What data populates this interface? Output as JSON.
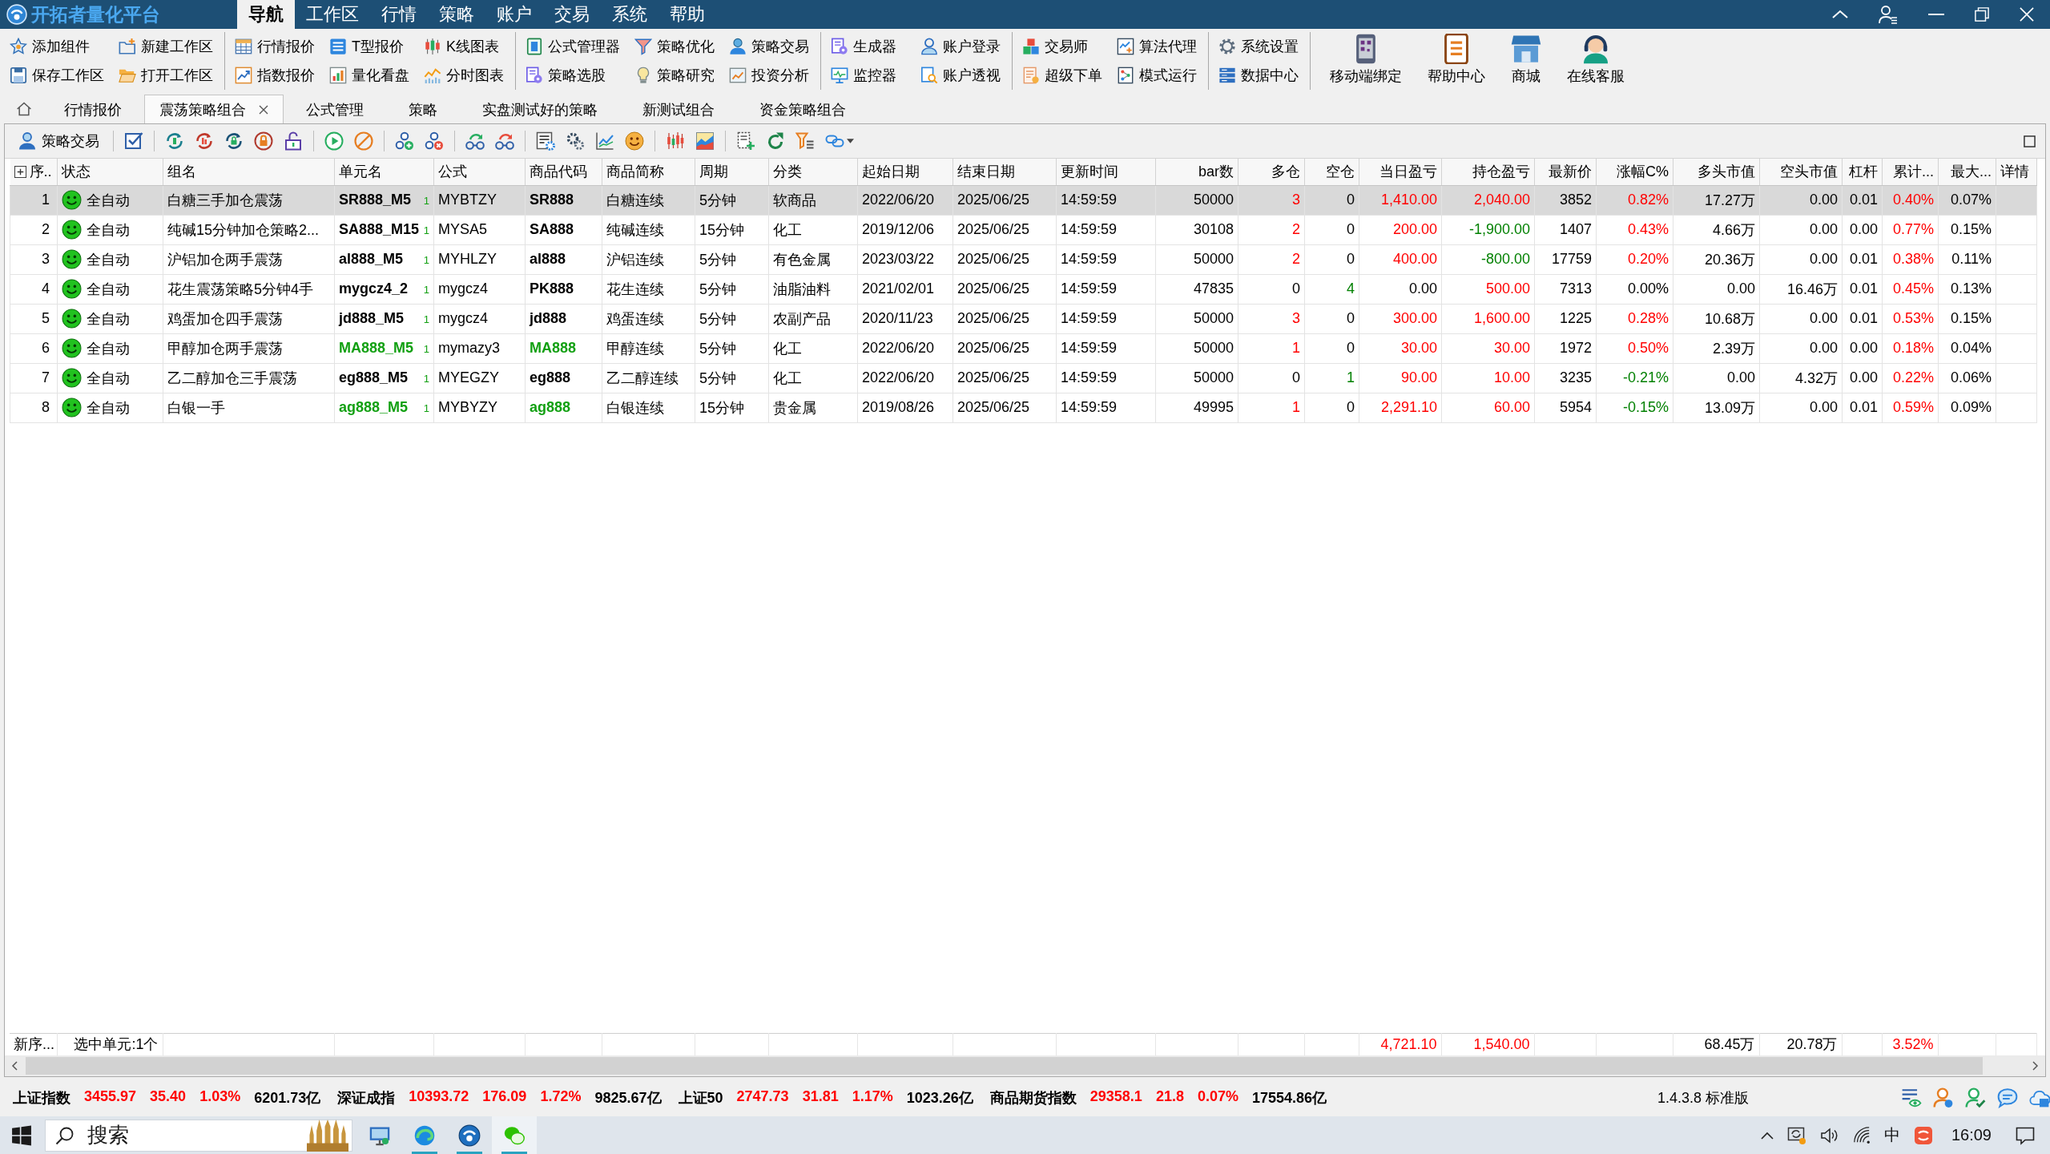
{
  "app_title": "开拓者量化平台",
  "menu": [
    {
      "label": "导航",
      "selected": true
    },
    {
      "label": "工作区",
      "selected": false
    },
    {
      "label": "行情",
      "selected": false
    },
    {
      "label": "策略",
      "selected": false
    },
    {
      "label": "账户",
      "selected": false
    },
    {
      "label": "交易",
      "selected": false
    },
    {
      "label": "系统",
      "selected": false
    },
    {
      "label": "帮助",
      "selected": false
    }
  ],
  "ribbon": {
    "groups": [
      {
        "buttons": [
          "添加组件",
          "新建工作区",
          "保存工作区",
          "打开工作区"
        ]
      },
      {
        "buttons": [
          "行情报价",
          "T型报价",
          "K线图表",
          "指数报价",
          "量化看盘",
          "分时图表"
        ]
      },
      {
        "buttons": [
          "公式管理器",
          "策略优化",
          "策略交易",
          "策略选股",
          "策略研究",
          "投资分析"
        ]
      },
      {
        "buttons": [
          "生成器",
          "账户登录",
          "监控器",
          "账户透视"
        ]
      },
      {
        "buttons": [
          "交易师",
          "算法代理",
          "超级下单",
          "模式运行"
        ]
      },
      {
        "buttons": [
          "系统设置",
          "数据中心"
        ]
      }
    ],
    "large_buttons": [
      "移动端绑定",
      "帮助中心",
      "商城",
      "在线客服"
    ]
  },
  "tabs": [
    {
      "label": "行情报价",
      "selected": false,
      "closable": false
    },
    {
      "label": "震荡策略组合",
      "selected": true,
      "closable": true
    },
    {
      "label": "公式管理",
      "selected": false,
      "closable": false
    },
    {
      "label": "策略",
      "selected": false,
      "closable": false
    },
    {
      "label": "实盘测试好的策略",
      "selected": false,
      "closable": false
    },
    {
      "label": "新测试组合",
      "selected": false,
      "closable": false
    },
    {
      "label": "资金策略组合",
      "selected": false,
      "closable": false
    }
  ],
  "panel_toolbar": {
    "button": "策略交易"
  },
  "table": {
    "columns": [
      {
        "label": "序..",
        "kind": "index",
        "footer": {
          "text": "新序..."
        }
      },
      {
        "label": "状态",
        "kind": "status",
        "footer": {
          "text": "选中单元:1个"
        }
      },
      {
        "label": "组名",
        "kind": "text"
      },
      {
        "label": "单元名",
        "kind": "unit"
      },
      {
        "label": "公式",
        "kind": "text"
      },
      {
        "label": "商品代码",
        "kind": "code"
      },
      {
        "label": "商品简称",
        "kind": "text"
      },
      {
        "label": "周期",
        "kind": "text"
      },
      {
        "label": "分类",
        "kind": "text"
      },
      {
        "label": "起始日期",
        "kind": "text"
      },
      {
        "label": "结束日期",
        "kind": "text"
      },
      {
        "label": "更新时间",
        "kind": "text"
      },
      {
        "label": "bar数",
        "kind": "number"
      },
      {
        "label": "多仓",
        "kind": "number"
      },
      {
        "label": "空仓",
        "kind": "number"
      },
      {
        "label": "当日盈亏",
        "kind": "number",
        "footer": {
          "text": "4,721.10",
          "color": "#ff0000"
        }
      },
      {
        "label": "持仓盈亏",
        "kind": "number",
        "footer": {
          "text": "1,540.00",
          "color": "#ff0000"
        }
      },
      {
        "label": "最新价",
        "kind": "number"
      },
      {
        "label": "涨幅C%",
        "kind": "number"
      },
      {
        "label": "多头市值",
        "kind": "number",
        "footer": {
          "text": "68.45万"
        }
      },
      {
        "label": "空头市值",
        "kind": "number",
        "footer": {
          "text": "20.78万"
        }
      },
      {
        "label": "杠杆",
        "kind": "number"
      },
      {
        "label": "累计...",
        "kind": "number",
        "footer": {
          "text": "3.52%",
          "color": "#ff0000"
        }
      },
      {
        "label": "最大...",
        "kind": "number"
      },
      {
        "label": "详情",
        "kind": "text"
      }
    ],
    "rows": [
      {
        "selected": true,
        "cells": [
          {
            "text": "1"
          },
          {
            "text": "全自动"
          },
          {
            "text": "白糖三手加仓震荡"
          },
          {
            "text": "SR888_M5",
            "count": "1"
          },
          {
            "text": "MYBTZY"
          },
          {
            "text": "SR888"
          },
          {
            "text": "白糖连续"
          },
          {
            "text": "5分钟"
          },
          {
            "text": "软商品"
          },
          {
            "text": "2022/06/20"
          },
          {
            "text": "2025/06/25"
          },
          {
            "text": "14:59:59"
          },
          {
            "text": "50000"
          },
          {
            "text": "3",
            "color": "#ff0000"
          },
          {
            "text": "0"
          },
          {
            "text": "1,410.00",
            "color": "#ff0000"
          },
          {
            "text": "2,040.00",
            "color": "#ff0000"
          },
          {
            "text": "3852"
          },
          {
            "text": "0.82%",
            "color": "#ff0000"
          },
          {
            "text": "17.27万"
          },
          {
            "text": "0.00"
          },
          {
            "text": "0.01"
          },
          {
            "text": "0.40%",
            "color": "#ff0000"
          },
          {
            "text": "0.07%"
          }
        ]
      },
      {
        "selected": false,
        "cells": [
          {
            "text": "2"
          },
          {
            "text": "全自动"
          },
          {
            "text": "纯碱15分钟加仓策略2..."
          },
          {
            "text": "SA888_M15",
            "count": "1"
          },
          {
            "text": "MYSA5"
          },
          {
            "text": "SA888"
          },
          {
            "text": "纯碱连续"
          },
          {
            "text": "15分钟"
          },
          {
            "text": "化工"
          },
          {
            "text": "2019/12/06"
          },
          {
            "text": "2025/06/25"
          },
          {
            "text": "14:59:59"
          },
          {
            "text": "30108"
          },
          {
            "text": "2",
            "color": "#ff0000"
          },
          {
            "text": "0"
          },
          {
            "text": "200.00",
            "color": "#ff0000"
          },
          {
            "text": "-1,900.00",
            "color": "#008000"
          },
          {
            "text": "1407"
          },
          {
            "text": "0.43%",
            "color": "#ff0000"
          },
          {
            "text": "4.66万"
          },
          {
            "text": "0.00"
          },
          {
            "text": "0.00"
          },
          {
            "text": "0.77%",
            "color": "#ff0000"
          },
          {
            "text": "0.15%"
          }
        ]
      },
      {
        "selected": false,
        "cells": [
          {
            "text": "3"
          },
          {
            "text": "全自动"
          },
          {
            "text": "沪铝加仓两手震荡"
          },
          {
            "text": "al888_M5",
            "count": "1"
          },
          {
            "text": "MYHLZY"
          },
          {
            "text": "al888"
          },
          {
            "text": "沪铝连续"
          },
          {
            "text": "5分钟"
          },
          {
            "text": "有色金属"
          },
          {
            "text": "2023/03/22"
          },
          {
            "text": "2025/06/25"
          },
          {
            "text": "14:59:59"
          },
          {
            "text": "50000"
          },
          {
            "text": "2",
            "color": "#ff0000"
          },
          {
            "text": "0"
          },
          {
            "text": "400.00",
            "color": "#ff0000"
          },
          {
            "text": "-800.00",
            "color": "#008000"
          },
          {
            "text": "17759"
          },
          {
            "text": "0.20%",
            "color": "#ff0000"
          },
          {
            "text": "20.36万"
          },
          {
            "text": "0.00"
          },
          {
            "text": "0.01"
          },
          {
            "text": "0.38%",
            "color": "#ff0000"
          },
          {
            "text": "0.11%"
          }
        ]
      },
      {
        "selected": false,
        "cells": [
          {
            "text": "4"
          },
          {
            "text": "全自动"
          },
          {
            "text": "花生震荡策略5分钟4手"
          },
          {
            "text": "mygcz4_2",
            "count": "1"
          },
          {
            "text": "mygcz4"
          },
          {
            "text": "PK888"
          },
          {
            "text": "花生连续"
          },
          {
            "text": "5分钟"
          },
          {
            "text": "油脂油料"
          },
          {
            "text": "2021/02/01"
          },
          {
            "text": "2025/06/25"
          },
          {
            "text": "14:59:59"
          },
          {
            "text": "47835"
          },
          {
            "text": "0"
          },
          {
            "text": "4",
            "color": "#008000"
          },
          {
            "text": "0.00"
          },
          {
            "text": "500.00",
            "color": "#ff0000"
          },
          {
            "text": "7313"
          },
          {
            "text": "0.00%"
          },
          {
            "text": "0.00"
          },
          {
            "text": "16.46万"
          },
          {
            "text": "0.01"
          },
          {
            "text": "0.45%",
            "color": "#ff0000"
          },
          {
            "text": "0.13%"
          }
        ]
      },
      {
        "selected": false,
        "cells": [
          {
            "text": "5"
          },
          {
            "text": "全自动"
          },
          {
            "text": "鸡蛋加仓四手震荡"
          },
          {
            "text": "jd888_M5",
            "count": "1"
          },
          {
            "text": "mygcz4"
          },
          {
            "text": "jd888"
          },
          {
            "text": "鸡蛋连续"
          },
          {
            "text": "5分钟"
          },
          {
            "text": "农副产品"
          },
          {
            "text": "2020/11/23"
          },
          {
            "text": "2025/06/25"
          },
          {
            "text": "14:59:59"
          },
          {
            "text": "50000"
          },
          {
            "text": "3",
            "color": "#ff0000"
          },
          {
            "text": "0"
          },
          {
            "text": "300.00",
            "color": "#ff0000"
          },
          {
            "text": "1,600.00",
            "color": "#ff0000"
          },
          {
            "text": "1225"
          },
          {
            "text": "0.28%",
            "color": "#ff0000"
          },
          {
            "text": "10.68万"
          },
          {
            "text": "0.00"
          },
          {
            "text": "0.01"
          },
          {
            "text": "0.53%",
            "color": "#ff0000"
          },
          {
            "text": "0.15%"
          }
        ]
      },
      {
        "selected": false,
        "cells": [
          {
            "text": "6"
          },
          {
            "text": "全自动"
          },
          {
            "text": "甲醇加仓两手震荡"
          },
          {
            "text": "MA888_M5",
            "count": "1",
            "color": "#12a012"
          },
          {
            "text": "mymazy3"
          },
          {
            "text": "MA888",
            "color": "#12a012"
          },
          {
            "text": "甲醇连续"
          },
          {
            "text": "5分钟"
          },
          {
            "text": "化工"
          },
          {
            "text": "2022/06/20"
          },
          {
            "text": "2025/06/25"
          },
          {
            "text": "14:59:59"
          },
          {
            "text": "50000"
          },
          {
            "text": "1",
            "color": "#ff0000"
          },
          {
            "text": "0"
          },
          {
            "text": "30.00",
            "color": "#ff0000"
          },
          {
            "text": "30.00",
            "color": "#ff0000"
          },
          {
            "text": "1972"
          },
          {
            "text": "0.50%",
            "color": "#ff0000"
          },
          {
            "text": "2.39万"
          },
          {
            "text": "0.00"
          },
          {
            "text": "0.00"
          },
          {
            "text": "0.18%",
            "color": "#ff0000"
          },
          {
            "text": "0.04%"
          }
        ]
      },
      {
        "selected": false,
        "cells": [
          {
            "text": "7"
          },
          {
            "text": "全自动"
          },
          {
            "text": "乙二醇加仓三手震荡"
          },
          {
            "text": "eg888_M5",
            "count": "1"
          },
          {
            "text": "MYEGZY"
          },
          {
            "text": "eg888"
          },
          {
            "text": "乙二醇连续"
          },
          {
            "text": "5分钟"
          },
          {
            "text": "化工"
          },
          {
            "text": "2022/06/20"
          },
          {
            "text": "2025/06/25"
          },
          {
            "text": "14:59:59"
          },
          {
            "text": "50000"
          },
          {
            "text": "0"
          },
          {
            "text": "1",
            "color": "#008000"
          },
          {
            "text": "90.00",
            "color": "#ff0000"
          },
          {
            "text": "10.00",
            "color": "#ff0000"
          },
          {
            "text": "3235"
          },
          {
            "text": "-0.21%",
            "color": "#008000"
          },
          {
            "text": "0.00"
          },
          {
            "text": "4.32万"
          },
          {
            "text": "0.00"
          },
          {
            "text": "0.22%",
            "color": "#ff0000"
          },
          {
            "text": "0.06%"
          }
        ]
      },
      {
        "selected": false,
        "cells": [
          {
            "text": "8"
          },
          {
            "text": "全自动"
          },
          {
            "text": "白银一手"
          },
          {
            "text": "ag888_M5",
            "count": "1",
            "color": "#12a012"
          },
          {
            "text": "MYBYZY"
          },
          {
            "text": "ag888",
            "color": "#12a012"
          },
          {
            "text": "白银连续"
          },
          {
            "text": "15分钟"
          },
          {
            "text": "贵金属"
          },
          {
            "text": "2019/08/26"
          },
          {
            "text": "2025/06/25"
          },
          {
            "text": "14:59:59"
          },
          {
            "text": "49995"
          },
          {
            "text": "1",
            "color": "#ff0000"
          },
          {
            "text": "0"
          },
          {
            "text": "2,291.10",
            "color": "#ff0000"
          },
          {
            "text": "60.00",
            "color": "#ff0000"
          },
          {
            "text": "5954"
          },
          {
            "text": "-0.15%",
            "color": "#008000"
          },
          {
            "text": "13.09万"
          },
          {
            "text": "0.00"
          },
          {
            "text": "0.01"
          },
          {
            "text": "0.59%",
            "color": "#ff0000"
          },
          {
            "text": "0.09%"
          }
        ]
      }
    ]
  },
  "status_bar": {
    "indices": [
      {
        "name": "上证指数",
        "price": "3455.97",
        "change": "35.40",
        "percent": "1.03%",
        "turnover": "6201.73亿",
        "color": "#ff0000"
      },
      {
        "name": "深证成指",
        "price": "10393.72",
        "change": "176.09",
        "percent": "1.72%",
        "turnover": "9825.67亿",
        "color": "#ff0000"
      },
      {
        "name": "上证50",
        "price": "2747.73",
        "change": "31.81",
        "percent": "1.17%",
        "turnover": "1023.26亿",
        "color": "#ff0000"
      },
      {
        "name": "商品期货指数",
        "price": "29358.1",
        "change": "21.8",
        "percent": "0.07%",
        "turnover": "17554.86亿",
        "color": "#ff0000"
      }
    ],
    "version": "1.4.3.8 标准版"
  },
  "taskbar": {
    "search": {
      "placeholder": "搜索"
    },
    "apps": [
      {
        "running": false,
        "selected": false
      },
      {
        "running": true,
        "selected": false
      },
      {
        "running": true,
        "selected": false
      },
      {
        "running": true,
        "selected": true
      }
    ],
    "ime": "中",
    "clock": "16:09"
  }
}
